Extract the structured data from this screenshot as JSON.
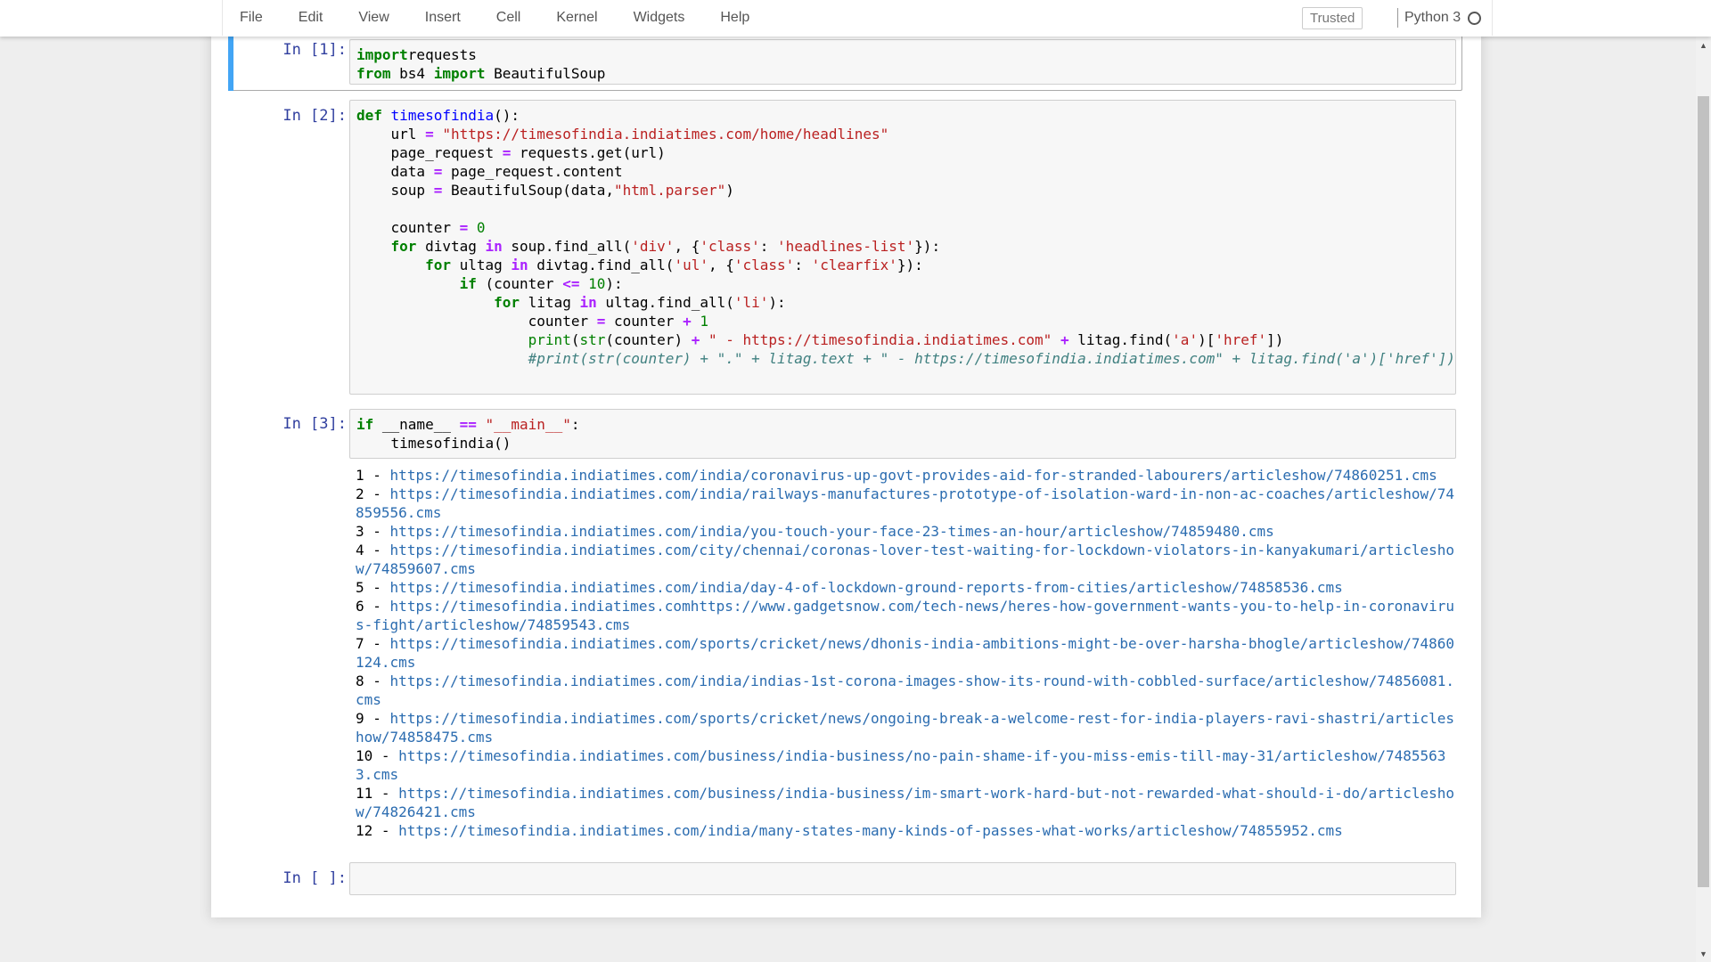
{
  "menubar": {
    "items": [
      "File",
      "Edit",
      "View",
      "Insert",
      "Cell",
      "Kernel",
      "Widgets",
      "Help"
    ],
    "trusted": "Trusted",
    "kernel_name": "Python 3"
  },
  "cells": [
    {
      "prompt": "In [1]:",
      "lines": [
        [
          [
            "kw",
            "import"
          ],
          [
            "",
            "requests"
          ]
        ],
        [
          [
            "kw",
            "from"
          ],
          [
            "",
            " bs4 "
          ],
          [
            "kw",
            "import"
          ],
          [
            "",
            " BeautifulSoup"
          ]
        ]
      ]
    },
    {
      "prompt": "In [2]:",
      "lines": [
        [
          [
            "kw",
            "def"
          ],
          [
            "",
            " "
          ],
          [
            "fn",
            "timesofindia"
          ],
          [
            "",
            "():"
          ]
        ],
        [
          [
            "",
            "    url "
          ],
          [
            "op",
            "="
          ],
          [
            "",
            " "
          ],
          [
            "st",
            "\"https://timesofindia.indiatimes.com/home/headlines\""
          ]
        ],
        [
          [
            "",
            "    page_request "
          ],
          [
            "op",
            "="
          ],
          [
            "",
            " requests.get(url)"
          ]
        ],
        [
          [
            "",
            "    data "
          ],
          [
            "op",
            "="
          ],
          [
            "",
            " page_request.content"
          ]
        ],
        [
          [
            "",
            "    soup "
          ],
          [
            "op",
            "="
          ],
          [
            "",
            " BeautifulSoup(data,"
          ],
          [
            "st",
            "\"html.parser\""
          ],
          [
            "",
            ")"
          ]
        ],
        [
          [
            "",
            ""
          ]
        ],
        [
          [
            "",
            "    counter "
          ],
          [
            "op",
            "="
          ],
          [
            "",
            " "
          ],
          [
            "nm",
            "0"
          ]
        ],
        [
          [
            "",
            "    "
          ],
          [
            "kw",
            "for"
          ],
          [
            "",
            " divtag "
          ],
          [
            "op",
            "in"
          ],
          [
            "",
            " soup.find_all("
          ],
          [
            "st",
            "'div'"
          ],
          [
            "",
            ", {"
          ],
          [
            "st",
            "'class'"
          ],
          [
            "",
            ": "
          ],
          [
            "st",
            "'headlines-list'"
          ],
          [
            "",
            "}):"
          ]
        ],
        [
          [
            "",
            "        "
          ],
          [
            "kw",
            "for"
          ],
          [
            "",
            " ultag "
          ],
          [
            "op",
            "in"
          ],
          [
            "",
            " divtag.find_all("
          ],
          [
            "st",
            "'ul'"
          ],
          [
            "",
            ", {"
          ],
          [
            "st",
            "'class'"
          ],
          [
            "",
            ": "
          ],
          [
            "st",
            "'clearfix'"
          ],
          [
            "",
            "}):"
          ]
        ],
        [
          [
            "",
            "            "
          ],
          [
            "kw",
            "if"
          ],
          [
            "",
            " (counter "
          ],
          [
            "op",
            "<="
          ],
          [
            "",
            " "
          ],
          [
            "nm",
            "10"
          ],
          [
            "",
            "):"
          ]
        ],
        [
          [
            "",
            "                "
          ],
          [
            "kw",
            "for"
          ],
          [
            "",
            " litag "
          ],
          [
            "op",
            "in"
          ],
          [
            "",
            " ultag.find_all("
          ],
          [
            "st",
            "'li'"
          ],
          [
            "",
            "):"
          ]
        ],
        [
          [
            "",
            "                    counter "
          ],
          [
            "op",
            "="
          ],
          [
            "",
            " counter "
          ],
          [
            "op",
            "+"
          ],
          [
            "",
            " "
          ],
          [
            "nm",
            "1"
          ]
        ],
        [
          [
            "",
            "                    "
          ],
          [
            "bi",
            "print"
          ],
          [
            "",
            "("
          ],
          [
            "bi",
            "str"
          ],
          [
            "",
            "(counter) "
          ],
          [
            "op",
            "+"
          ],
          [
            "",
            " "
          ],
          [
            "st",
            "\" - https://timesofindia.indiatimes.com\""
          ],
          [
            "",
            " "
          ],
          [
            "op",
            "+"
          ],
          [
            "",
            " litag.find("
          ],
          [
            "st",
            "'a'"
          ],
          [
            "",
            ")["
          ],
          [
            "st",
            "'href'"
          ],
          [
            "",
            "])"
          ]
        ],
        [
          [
            "",
            "                    "
          ],
          [
            "cm",
            "#print(str(counter) + \".\" + litag.text + \" - https://timesofindia.indiatimes.com\" + litag.find('a')['href'])"
          ]
        ]
      ]
    },
    {
      "prompt": "In [3]:",
      "lines": [
        [
          [
            "kw",
            "if"
          ],
          [
            "",
            " __name__ "
          ],
          [
            "op",
            "=="
          ],
          [
            "",
            " "
          ],
          [
            "st",
            "\"__main__\""
          ],
          [
            "",
            ":"
          ]
        ],
        [
          [
            "",
            "    timesofindia()"
          ]
        ]
      ],
      "output": [
        {
          "n": "1",
          "url": "https://timesofindia.indiatimes.com/india/coronavirus-up-govt-provides-aid-for-stranded-labourers/articleshow/74860251.cms"
        },
        {
          "n": "2",
          "url": "https://timesofindia.indiatimes.com/india/railways-manufactures-prototype-of-isolation-ward-in-non-ac-coaches/articleshow/74859556.cms"
        },
        {
          "n": "3",
          "url": "https://timesofindia.indiatimes.com/india/you-touch-your-face-23-times-an-hour/articleshow/74859480.cms"
        },
        {
          "n": "4",
          "url": "https://timesofindia.indiatimes.com/city/chennai/coronas-lover-test-waiting-for-lockdown-violators-in-kanyakumari/articleshow/74859607.cms"
        },
        {
          "n": "5",
          "url": "https://timesofindia.indiatimes.com/india/day-4-of-lockdown-ground-reports-from-cities/articleshow/74858536.cms"
        },
        {
          "n": "6",
          "url": "https://timesofindia.indiatimes.comhttps://www.gadgetsnow.com/tech-news/heres-how-government-wants-you-to-help-in-coronavirus-fight/articleshow/74859543.cms"
        },
        {
          "n": "7",
          "url": "https://timesofindia.indiatimes.com/sports/cricket/news/dhonis-india-ambitions-might-be-over-harsha-bhogle/articleshow/74860124.cms"
        },
        {
          "n": "8",
          "url": "https://timesofindia.indiatimes.com/india/indias-1st-corona-images-show-its-round-with-cobbled-surface/articleshow/74856081.cms"
        },
        {
          "n": "9",
          "url": "https://timesofindia.indiatimes.com/sports/cricket/news/ongoing-break-a-welcome-rest-for-india-players-ravi-shastri/articleshow/74858475.cms"
        },
        {
          "n": "10",
          "url": "https://timesofindia.indiatimes.com/business/india-business/no-pain-shame-if-you-miss-emis-till-may-31/articleshow/74855633.cms"
        },
        {
          "n": "11",
          "url": "https://timesofindia.indiatimes.com/business/india-business/im-smart-work-hard-but-not-rewarded-what-should-i-do/articleshow/74826421.cms"
        },
        {
          "n": "12",
          "url": "https://timesofindia.indiatimes.com/india/many-states-many-kinds-of-passes-what-works/articleshow/74855952.cms"
        }
      ]
    },
    {
      "prompt": "In [ ]:",
      "lines": []
    }
  ],
  "colors": {
    "selected_bar": "#42a5f5",
    "prompt": "#303f9f",
    "link": "#2b6cb0"
  },
  "icons": {
    "kernel_status": "kernel-idle-circle-icon",
    "scroll_up": "scroll-up-arrow-icon",
    "scroll_down": "scroll-down-arrow-icon"
  }
}
